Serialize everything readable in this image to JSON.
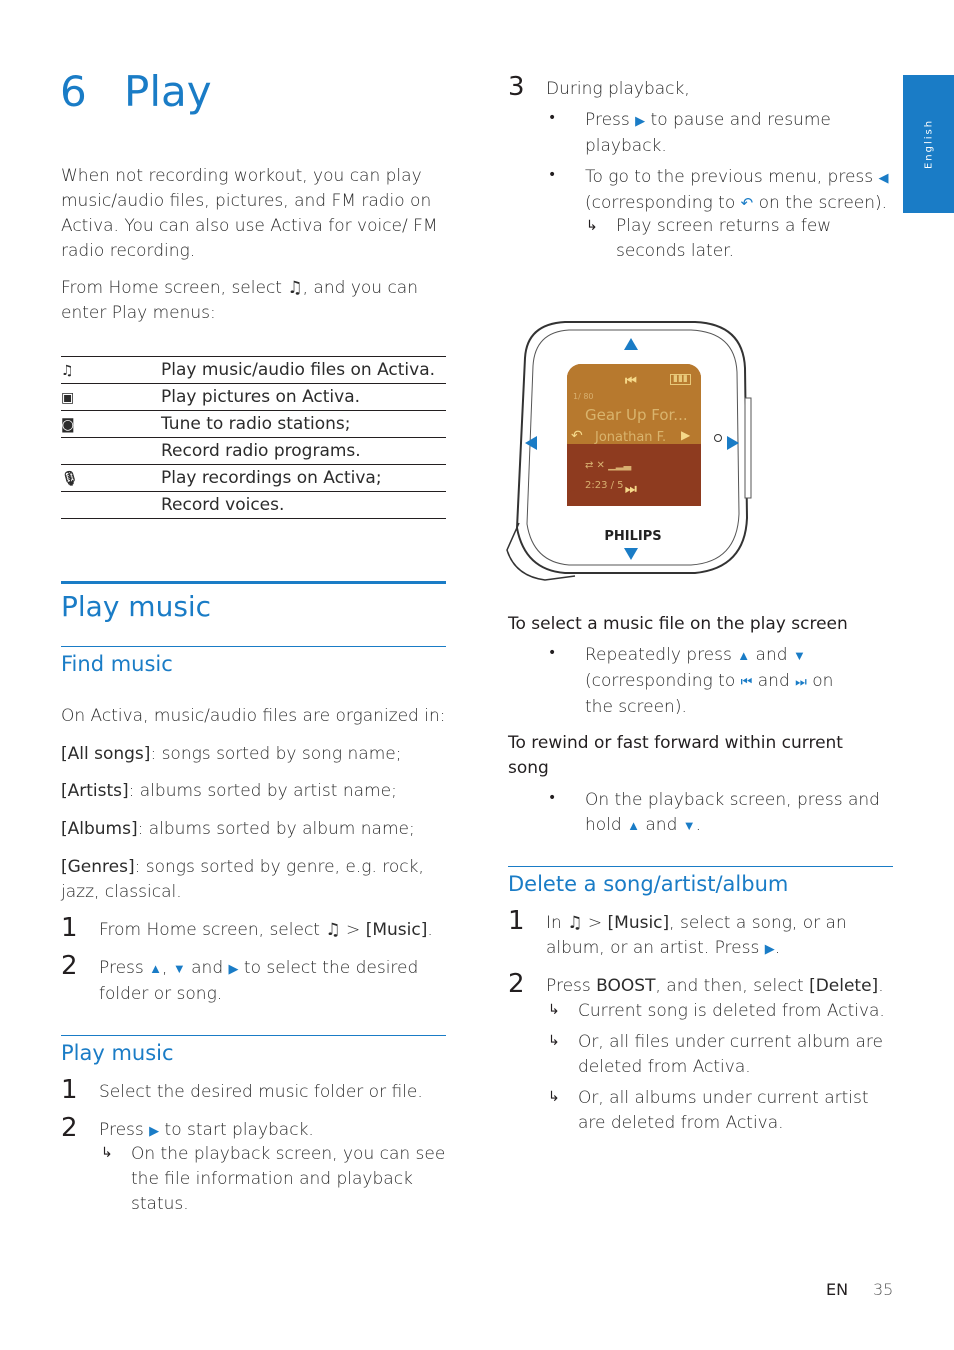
{
  "chapter": {
    "number": "6",
    "title": "Play"
  },
  "language_tab": "English",
  "intro": {
    "paragraph1": "When not recording workout, you can play music/audio files, pictures, and FM radio on Activa. You can also use Activa for voice/ FM radio recording.",
    "paragraph2_before": "From Home screen, select ",
    "paragraph2_after": ", and you can enter Play menus:"
  },
  "menu_table": [
    {
      "icon": "music-note-icon",
      "text": "Play music/audio files on Activa."
    },
    {
      "icon": "pictures-icon",
      "text": "Play pictures on Activa."
    },
    {
      "icon": "radio-icon",
      "text": "Tune to radio stations;"
    },
    {
      "icon": "",
      "text": "Record radio programs."
    },
    {
      "icon": "microphone-icon",
      "text": "Play recordings on Activa;"
    },
    {
      "icon": "",
      "text": "Record voices."
    }
  ],
  "play_music": {
    "heading": "Play music",
    "find_music": {
      "heading": "Find music",
      "intro": "On Activa, music/audio files are organized in:",
      "categories": [
        {
          "label": "[All songs]",
          "desc": ": songs sorted by song name;"
        },
        {
          "label": "[Artists]",
          "desc": ": albums sorted by artist name;"
        },
        {
          "label": "[Albums]",
          "desc": ": albums sorted by album name;"
        },
        {
          "label": "[Genres]",
          "desc": ": songs sorted by genre, e.g. rock, jazz, classical."
        }
      ],
      "steps": [
        {
          "num": "1",
          "before": "From Home screen, select ",
          "between": " > ",
          "bold": "[Music]",
          "after": "."
        },
        {
          "num": "2",
          "p1": "Press ",
          "p2": ", ",
          "p3": " and ",
          "p4": " to select the desired folder or song."
        }
      ]
    },
    "play_sub": {
      "heading": "Play music",
      "steps": [
        {
          "num": "1",
          "text": "Select the desired music folder or file."
        },
        {
          "num": "2",
          "before": "Press ",
          "after": " to start playback.",
          "result": "On the playback screen, you can see the file information and playback status."
        }
      ]
    }
  },
  "right_col": {
    "step3": {
      "num": "3",
      "text": "During playback,",
      "bullet1_before": "Press ",
      "bullet1_after": " to pause and resume playback.",
      "bullet2_before": "To go to the previous menu, press ",
      "bullet2_mid": " (corresponding to ",
      "bullet2_after": " on the screen).",
      "result": "Play screen returns a few seconds later."
    },
    "device": {
      "brand": "PHILIPS",
      "track_counter": "1/ 80",
      "song_title": "Gear Up For...",
      "artist": "Jonathan F.",
      "elapsed": "2:23 / 5"
    },
    "select_file": {
      "heading": "To select a music file on the play screen",
      "p1": "Repeatedly press ",
      "p2": " and ",
      "p3": " (corresponding to ",
      "p4": " and ",
      "p5": " on the screen)."
    },
    "rewind": {
      "heading": "To rewind or fast forward within current song",
      "p1": "On the playback screen, press and hold ",
      "p2": " and ",
      "p3": "."
    },
    "delete": {
      "heading": "Delete a song/artist/album",
      "step1": {
        "num": "1",
        "p1": "In ",
        "p2": " > ",
        "bold": "[Music]",
        "p3": ", select a song, or an album, or an artist. Press ",
        "p4": "."
      },
      "step2": {
        "num": "2",
        "p1": "Press ",
        "bold1": "BOOST",
        "p2": ", and then, select ",
        "bold2": "[Delete]",
        "p3": "."
      },
      "results": [
        "Current song is deleted from Activa.",
        "Or, all files under current album are deleted from Activa.",
        "Or, all albums under current artist are deleted from Activa."
      ]
    }
  },
  "footer": {
    "lang": "EN",
    "page": "35"
  },
  "colors": {
    "accent": "#1a7cc6",
    "text": "#231f20"
  }
}
